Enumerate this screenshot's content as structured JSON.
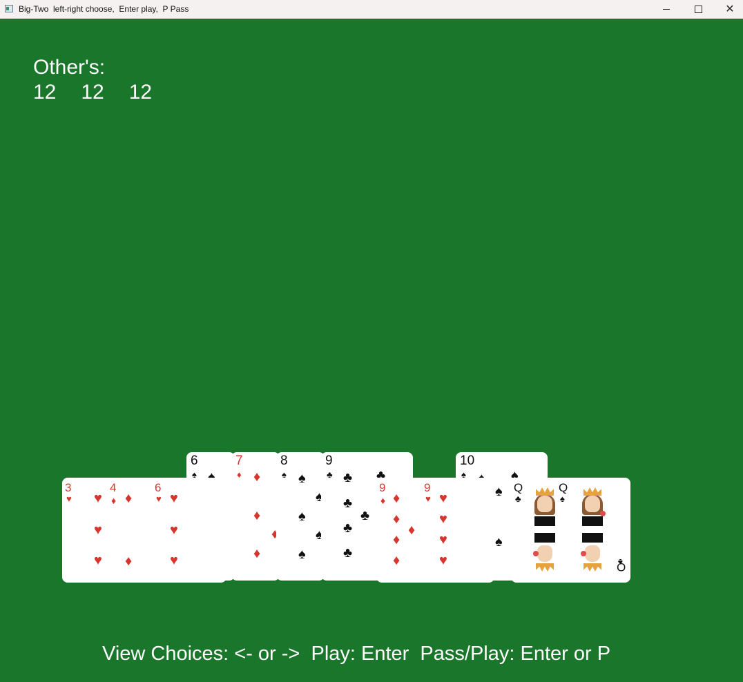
{
  "window": {
    "title": "Big-Two  left-right choose,  Enter play,  P Pass",
    "icon": "app-icon",
    "controls": [
      "minimize-icon",
      "maximize-icon",
      "close-icon"
    ]
  },
  "others": {
    "label": "Other's:",
    "counts": [
      "12",
      "12",
      "12"
    ]
  },
  "hand": {
    "back_row": [
      {
        "rank": "6",
        "suit": "♠",
        "color": "black"
      },
      {
        "rank": "7",
        "suit": "♦",
        "color": "red"
      },
      {
        "rank": "8",
        "suit": "♠",
        "color": "black"
      },
      {
        "rank": "9",
        "suit": "♣",
        "color": "black"
      },
      {
        "rank": "10",
        "suit": "♠",
        "color": "black"
      }
    ],
    "front_row": [
      {
        "rank": "3",
        "suit": "♥",
        "color": "red"
      },
      {
        "rank": "4",
        "suit": "♦",
        "color": "red"
      },
      {
        "rank": "6",
        "suit": "♥",
        "color": "red"
      },
      {
        "rank": "9",
        "suit": "♦",
        "color": "red"
      },
      {
        "rank": "9",
        "suit": "♥",
        "color": "red"
      },
      {
        "rank": "Q",
        "suit": "♣",
        "color": "black"
      },
      {
        "rank": "Q",
        "suit": "♠",
        "color": "black"
      }
    ]
  },
  "instructions": "View Choices: <- or ->  Play: Enter  Pass/Play: Enter or P",
  "colors": {
    "table": "#1a762b",
    "red_suit": "#d7362e",
    "black_suit": "#111111",
    "text": "#ffffff"
  }
}
